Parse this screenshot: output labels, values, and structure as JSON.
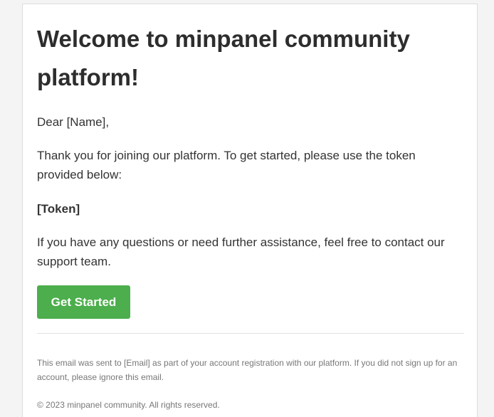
{
  "email": {
    "title": "Welcome to minpanel community platform!",
    "greeting": "Dear [Name],",
    "intro": "Thank you for joining our platform. To get started, please use the token provided below:",
    "token": "[Token]",
    "support": "If you have any questions or need further assistance, feel free to contact our support team.",
    "cta_label": "Get Started",
    "footer_notice": "This email was sent to [Email] as part of your account registration with our platform. If you did not sign up for an account, please ignore this email.",
    "copyright": "© 2023 minpanel community. All rights reserved."
  },
  "colors": {
    "background": "#f4f4f4",
    "card": "#ffffff",
    "button": "#4cae4c",
    "button_text": "#ffffff",
    "heading": "#2d2d2d",
    "body_text": "#333333",
    "muted_text": "#777777"
  }
}
